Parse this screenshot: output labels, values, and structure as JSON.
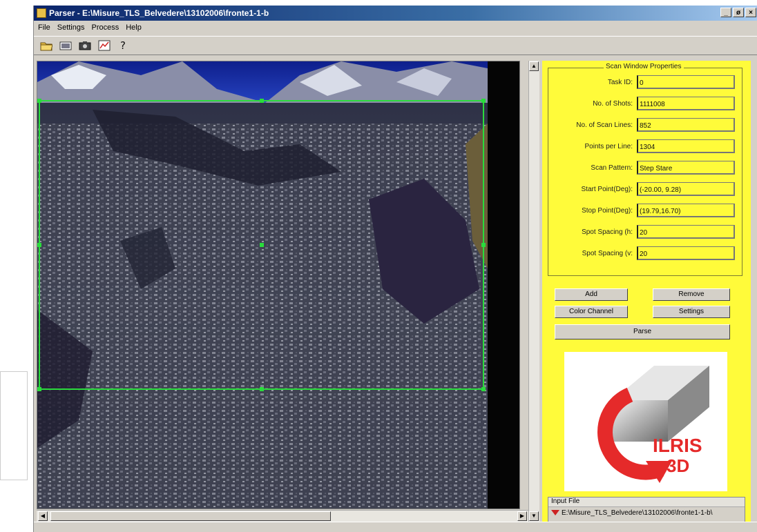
{
  "window": {
    "title": "Parser - E:\\Misure_TLS_Belvedere\\13102006\\fronte1-1-b",
    "controls": [
      "_",
      "ø",
      "×"
    ]
  },
  "menu": [
    "File",
    "Settings",
    "Process",
    "Help"
  ],
  "toolbar": {
    "icons": [
      "open-folder-icon",
      "image-icon",
      "camera-icon",
      "chart-icon",
      "help-icon"
    ]
  },
  "scan_window": {
    "title": "Scan Window Properties",
    "fields": [
      {
        "label": "Task ID:",
        "value": "0"
      },
      {
        "label": "No. of Shots:",
        "value": "1111008"
      },
      {
        "label": "No. of Scan Lines:",
        "value": "852"
      },
      {
        "label": "Points per Line:",
        "value": "1304"
      },
      {
        "label": "Scan Pattern:",
        "value": "Step Stare"
      },
      {
        "label": "Start Point(Deg):",
        "value": "(-20.00, 9.28)"
      },
      {
        "label": "Stop Point(Deg):",
        "value": "(19.79,16.70)"
      },
      {
        "label": "Spot Spacing (h:",
        "value": "20"
      },
      {
        "label": "Spot Spacing (v:",
        "value": "20"
      }
    ]
  },
  "buttons": {
    "add": "Add",
    "remove": "Remove",
    "color_channel": "Color Channel",
    "settings": "Settings",
    "parse": "Parse"
  },
  "logo": {
    "line1": "ILRIS",
    "line2": "3D"
  },
  "input_file": {
    "header": "Input File",
    "path": "E:\\Misure_TLS_Belvedere\\13102006\\fronte1-1-b\\"
  },
  "colors": {
    "panel": "#fffb3a",
    "selection": "#2adc3c",
    "titlebar": "#0a246a",
    "logo_red": "#e52a2a"
  }
}
